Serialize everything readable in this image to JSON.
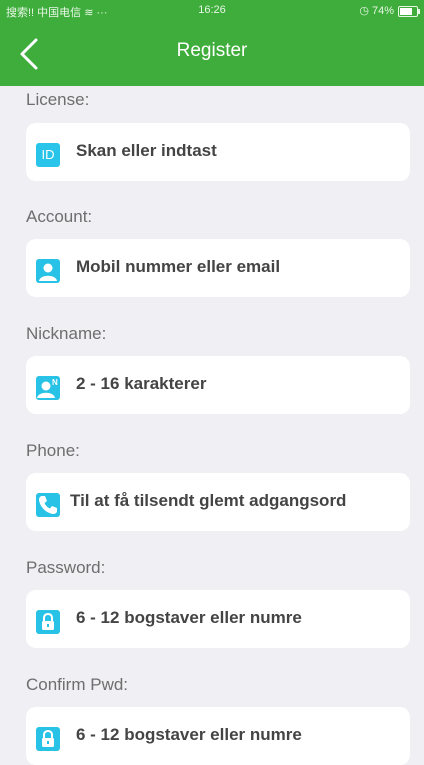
{
  "status_bar": {
    "carrier": "搜索!! 中国电信 ≋ ···",
    "time": "16:26",
    "battery": "◷ 74%"
  },
  "header": {
    "title": "Register",
    "back_icon": "chevron-left-icon"
  },
  "form": {
    "license": {
      "label": "License:",
      "placeholder": "Skan eller indtast",
      "icon": "id-icon",
      "icon_text": "ID"
    },
    "account": {
      "label": "Account:",
      "placeholder": "Mobil nummer eller email",
      "icon": "user-icon"
    },
    "nickname": {
      "label": "Nickname:",
      "placeholder": "2 - 16 karakterer",
      "icon": "user-name-icon"
    },
    "phone": {
      "label": "Phone:",
      "placeholder": "Til at få tilsendt glemt adgangsord",
      "icon": "phone-icon"
    },
    "password": {
      "label": "Password:",
      "placeholder": "6 - 12 bogstaver eller numre",
      "icon": "lock-icon"
    },
    "confirm": {
      "label": "Confirm Pwd:",
      "placeholder": "6 - 12 bogstaver eller numre",
      "icon": "lock-icon"
    }
  },
  "colors": {
    "header_green": "#3fad3c",
    "background": "#efeff4",
    "icon_blue": "#28c2e6",
    "field_white": "#ffffff"
  }
}
